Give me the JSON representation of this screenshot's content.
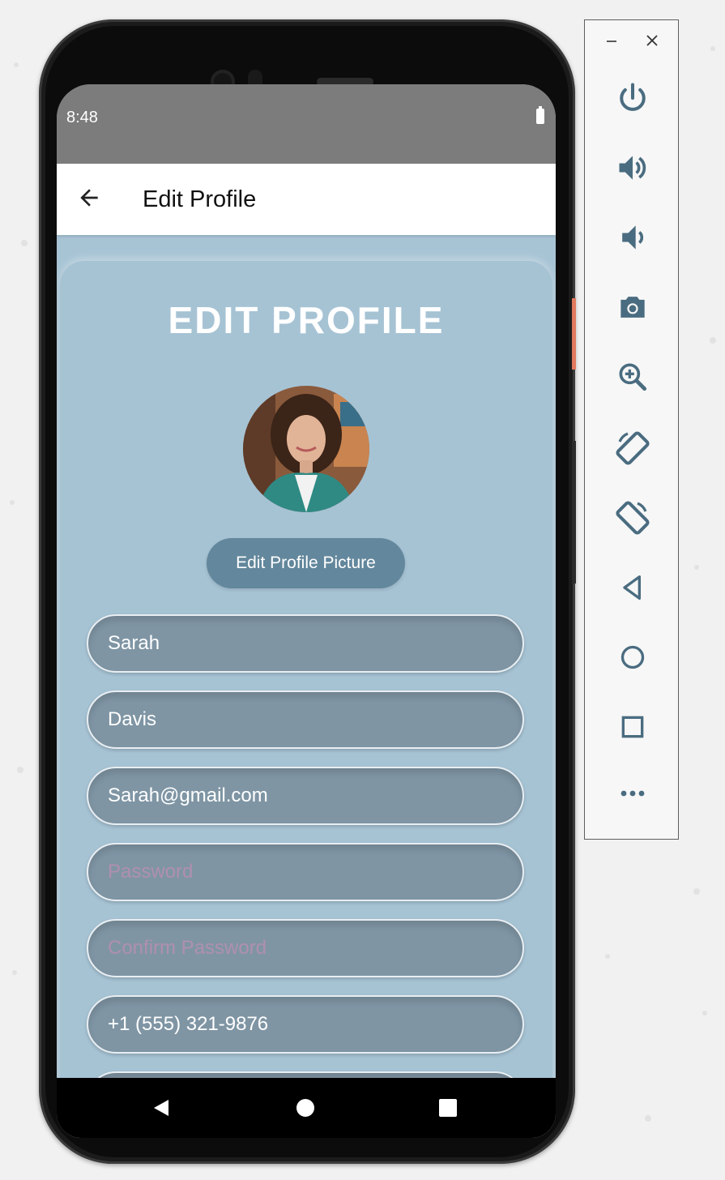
{
  "status_bar": {
    "time": "8:48"
  },
  "app_bar": {
    "title": "Edit Profile"
  },
  "profile": {
    "heading": "EDIT PROFILE",
    "edit_picture_label": "Edit Profile Picture",
    "first_name": "Sarah",
    "last_name": "Davis",
    "email": "Sarah@gmail.com",
    "password_placeholder": "Password",
    "confirm_password_placeholder": "Confirm Password",
    "phone": "+1 (555) 321-9876"
  },
  "emulator_panel": {
    "buttons": [
      "power-icon",
      "volume-up-icon",
      "volume-down-icon",
      "camera-icon",
      "zoom-icon",
      "rotate-left-icon",
      "rotate-right-icon",
      "back-icon",
      "home-icon",
      "overview-icon",
      "more-icon"
    ]
  },
  "colors": {
    "screen_bg": "#a7c4d5",
    "field_bg": "#7f95a4",
    "button_bg": "#63879c",
    "placeholder": "#b08fb0",
    "panel_icon": "#4a6c80"
  }
}
